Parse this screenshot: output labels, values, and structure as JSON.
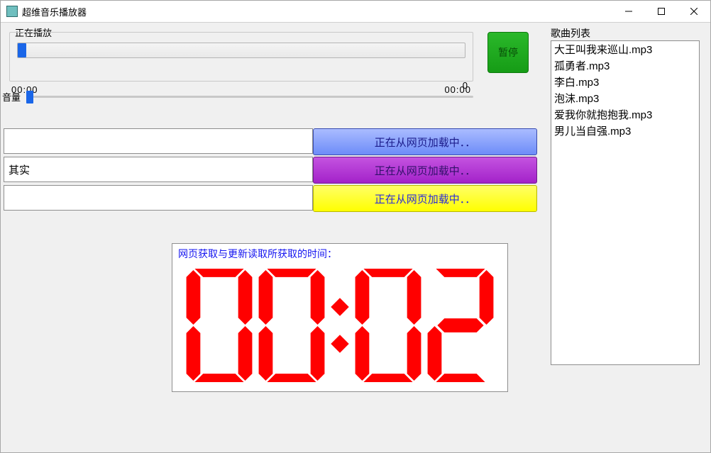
{
  "window": {
    "title": "超维音乐播放器"
  },
  "now_playing": {
    "legend": "正在播放",
    "time_current": "00:00",
    "time_total": "00:00"
  },
  "controls": {
    "pause_label": "暂停",
    "volume_label": "音量",
    "volume_value": "0"
  },
  "inputs": {
    "field1_value": "",
    "field2_value": "其实",
    "field3_value": "",
    "loading1": "正在从网页加载中．．",
    "loading2": "正在从网页加载中．．",
    "loading3": "正在从网页加载中．．"
  },
  "clock": {
    "caption": "网页获取与更新读取所获取的时间：",
    "digits": [
      "0",
      "0",
      "0",
      "2"
    ]
  },
  "playlist": {
    "label": "歌曲列表",
    "items": [
      "大王叫我来巡山.mp3",
      "孤勇者.mp3",
      "李白.mp3",
      "泡沫.mp3",
      "爱我你就抱抱我.mp3",
      "男儿当自强.mp3"
    ]
  }
}
